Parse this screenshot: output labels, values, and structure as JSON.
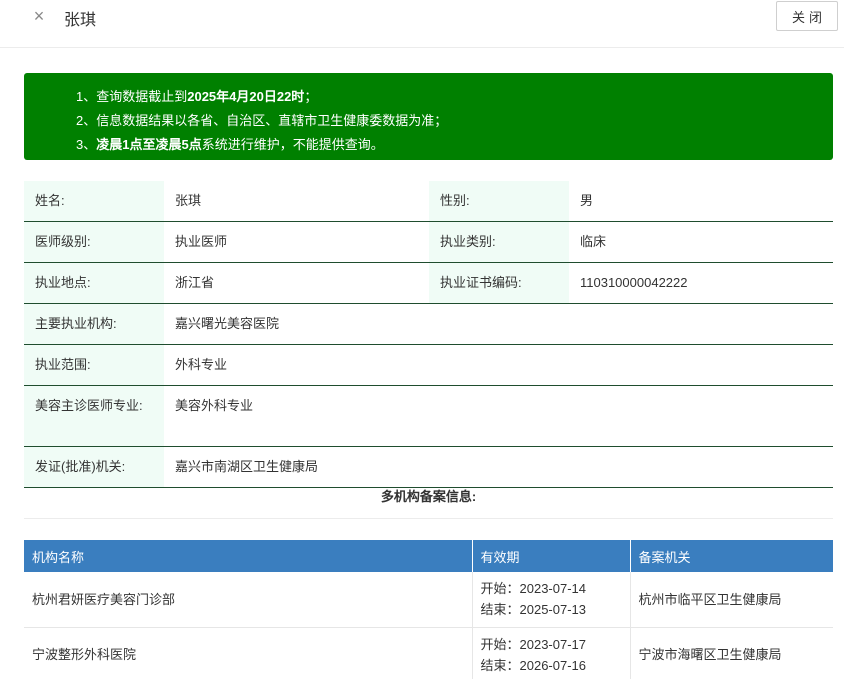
{
  "header": {
    "close_icon": "×",
    "title": "张琪",
    "close_label": "关闭"
  },
  "notice": {
    "line1_prefix": "1、查询数据截止到",
    "line1_bold": "2025年4月20日22时",
    "line1_suffix": "；",
    "line2": "2、信息数据结果以各省、自治区、直辖市卫生健康委数据为准；",
    "line3_prefix": "3、",
    "line3_bold": "凌晨1点至凌晨5点",
    "line3_suffix": "系统进行维护，不能提供查询。",
    "bg_color": "#008000"
  },
  "info": {
    "name_label": "姓名:",
    "name_value": "张琪",
    "gender_label": "性别:",
    "gender_value": "男",
    "level_label": "医师级别:",
    "level_value": "执业医师",
    "category_label": "执业类别:",
    "category_value": "临床",
    "location_label": "执业地点:",
    "location_value": "浙江省",
    "cert_label": "执业证书编码:",
    "cert_value": "110310000042222",
    "org_label": "主要执业机构:",
    "org_value": "嘉兴曙光美容医院",
    "scope_label": "执业范围:",
    "scope_value": "外科专业",
    "cosmetic_label": "美容主诊医师专业:",
    "cosmetic_value": "美容外科专业",
    "issuer_label": "发证(批准)机关:",
    "issuer_value": "嘉兴市南湖区卫生健康局"
  },
  "multi": {
    "title": "多机构备案信息:",
    "headers": [
      "机构名称",
      "有效期",
      "备案机关"
    ],
    "rows": [
      {
        "name": "杭州君妍医疗美容门诊部",
        "start": "开始：2023-07-14",
        "end": "结束：2025-07-13",
        "authority": "杭州市临平区卫生健康局"
      },
      {
        "name": "宁波整形外科医院",
        "start": "开始：2023-07-17",
        "end": "结束：2026-07-16",
        "authority": "宁波市海曙区卫生健康局"
      }
    ],
    "header_color": "#3a7ebf"
  }
}
